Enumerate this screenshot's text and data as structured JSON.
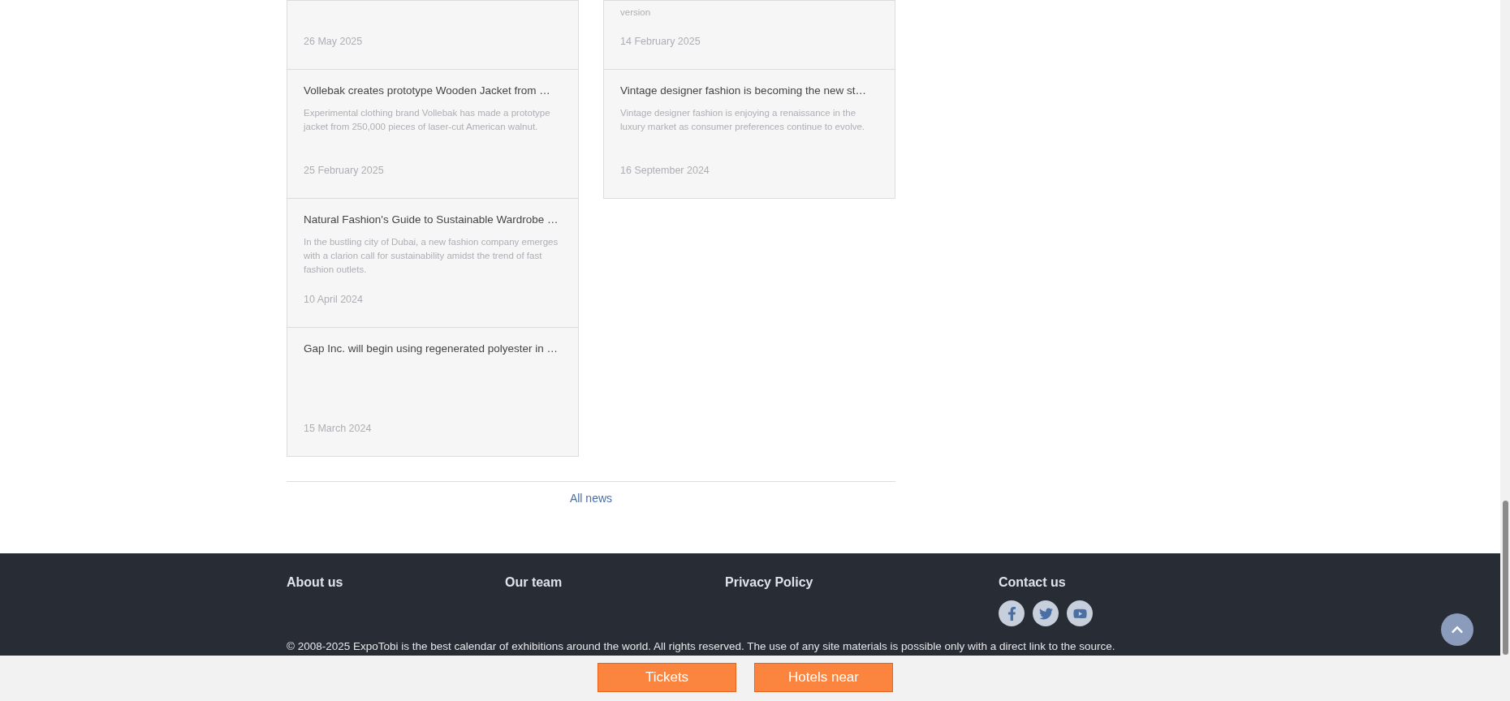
{
  "news": {
    "columns": [
      {
        "cards": [
          {
            "date": "26 May 2025"
          },
          {
            "title": "Vollebak creates prototype Wooden Jacket from …",
            "summary": "Experimental clothing brand Vollebak has made a prototype jacket from 250,000 pieces of laser-cut American walnut.",
            "date": "25 February 2025"
          },
          {
            "title": "Natural Fashion's Guide to Sustainable Wardrobe …",
            "summary": "In the bustling city of Dubai, a new fashion company emerges with a clarion call for sustainability amidst the trend of fast fashion outlets.",
            "date": "10 April 2024"
          },
          {
            "title": "Gap Inc. will begin using regenerated polyester in …",
            "date": "15 March 2024"
          }
        ]
      },
      {
        "cards": [
          {
            "summary": "version",
            "date": "14 February 2025"
          },
          {
            "title": "Vintage designer fashion is becoming the new st…",
            "summary": "Vintage designer fashion is enjoying a renaissance in the luxury market as consumer preferences continue to evolve.",
            "date": "16 September 2024"
          }
        ]
      }
    ],
    "all_link": "All news"
  },
  "footer": {
    "links": [
      "About us",
      "Our team",
      "Privacy Policy",
      "Contact us"
    ],
    "social": [
      {
        "kind": "facebook"
      },
      {
        "kind": "twitter"
      },
      {
        "kind": "youtube"
      }
    ],
    "copyright": "© 2008-2025 ExpoTobi is the best calendar of exhibitions around the world. All rights reserved. The use of any site materials is possible only with a direct link to the source."
  },
  "bottom_bar": {
    "buttons": [
      "Tickets",
      "Hotels near"
    ]
  }
}
